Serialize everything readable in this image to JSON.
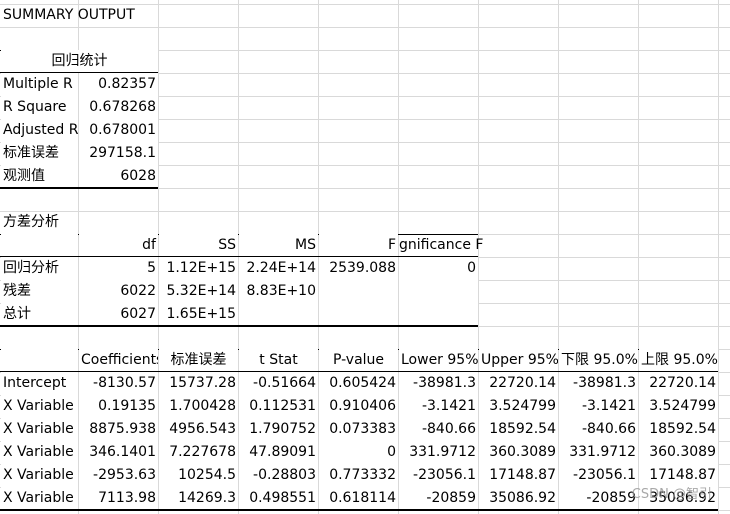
{
  "title": "SUMMARY OUTPUT",
  "regression_stats": {
    "header": "回归统计",
    "rows": [
      {
        "label": "Multiple R",
        "value": "0.82357"
      },
      {
        "label": "R Square",
        "value": "0.678268"
      },
      {
        "label": "Adjusted R",
        "value": "0.678001"
      },
      {
        "label": "标准误差",
        "value": "297158.1"
      },
      {
        "label": "观测值",
        "value": "6028"
      }
    ]
  },
  "anova": {
    "title": "方差分析",
    "headers": [
      "",
      "df",
      "SS",
      "MS",
      "F",
      "gnificance F"
    ],
    "rows": [
      [
        "回归分析",
        "5",
        "1.12E+15",
        "2.24E+14",
        "2539.088",
        "0"
      ],
      [
        "残差",
        "6022",
        "5.32E+14",
        "8.83E+10",
        "",
        ""
      ],
      [
        "总计",
        "6027",
        "1.65E+15",
        "",
        "",
        ""
      ]
    ]
  },
  "coefficients": {
    "headers": [
      "",
      "Coefficients",
      "标准误差",
      "t Stat",
      "P-value",
      "Lower 95%",
      "Upper 95%",
      "下限 95.0%",
      "上限 95.0%"
    ],
    "rows": [
      [
        "Intercept",
        "-8130.57",
        "15737.28",
        "-0.51664",
        "0.605424",
        "-38981.3",
        "22720.14",
        "-38981.3",
        "22720.14"
      ],
      [
        "X Variable",
        "0.19135",
        "1.700428",
        "0.112531",
        "0.910406",
        "-3.1421",
        "3.524799",
        "-3.1421",
        "3.524799"
      ],
      [
        "X Variable",
        "8875.938",
        "4956.543",
        "1.790752",
        "0.073383",
        "-840.66",
        "18592.54",
        "-840.66",
        "18592.54"
      ],
      [
        "X Variable",
        "346.1401",
        "7.227678",
        "47.89091",
        "0",
        "331.9712",
        "360.3089",
        "331.9712",
        "360.3089"
      ],
      [
        "X Variable",
        "-2953.63",
        "10254.5",
        "-0.28803",
        "0.773332",
        "-23056.1",
        "17148.87",
        "-23056.1",
        "17148.87"
      ],
      [
        "X Variable",
        "7113.98",
        "14269.3",
        "0.498551",
        "0.618114",
        "-20859",
        "35086.92",
        "-20859",
        "35086.92"
      ]
    ]
  },
  "watermark": "CSDN @智引"
}
